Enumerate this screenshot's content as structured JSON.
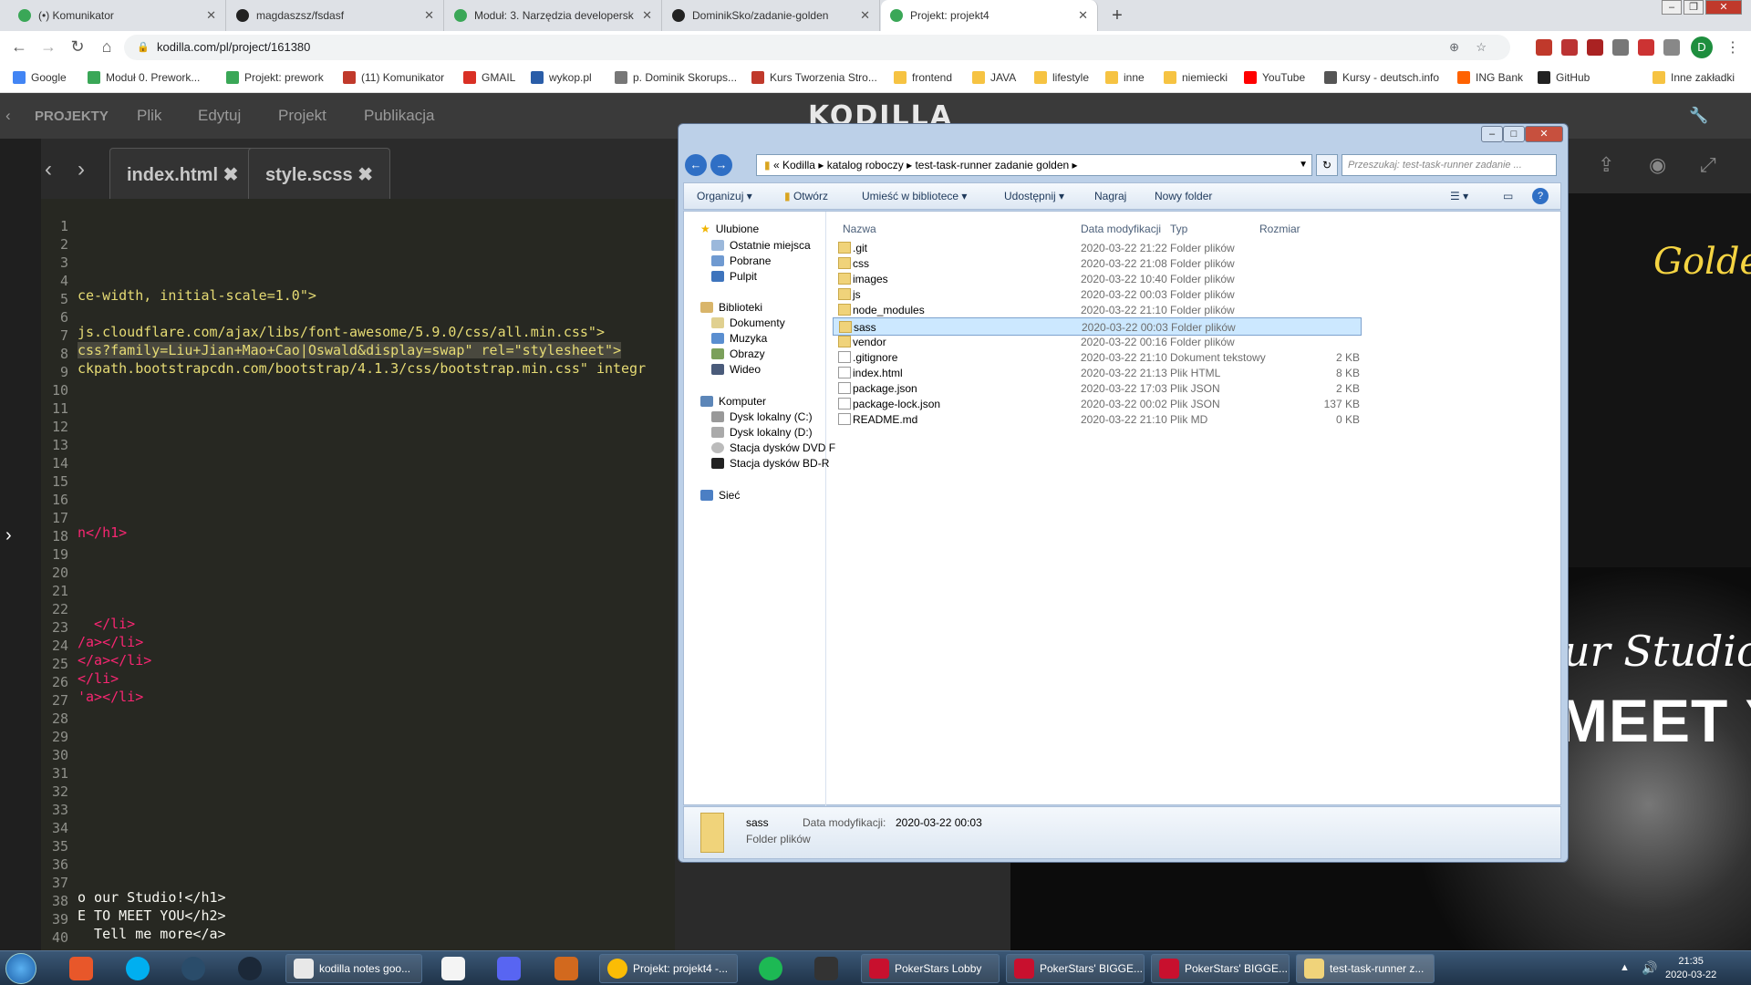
{
  "browser": {
    "tabs": [
      {
        "label": "(•) Komunikator",
        "color": "#3aa757"
      },
      {
        "label": "magdaszsz/fsdasf",
        "color": "#222222"
      },
      {
        "label": "Moduł: 3. Narzędzia developersk",
        "color": "#3aa757"
      },
      {
        "label": "DominikSko/zadanie-golden",
        "color": "#222222"
      },
      {
        "label": "Projekt: projekt4",
        "color": "#3aa757"
      }
    ],
    "url": "kodilla.com/pl/project/161380",
    "profile_initial": "D",
    "bookmarks": [
      "Google",
      "Moduł 0. Prework...",
      "Projekt: prework",
      "(11) Komunikator",
      "GMAIL",
      "wykop.pl",
      "p. Dominik Skorups...",
      "Kurs Tworzenia Stro...",
      "frontend",
      "JAVA",
      "lifestyle",
      "inne",
      "niemiecki",
      "YouTube",
      "Kursy - deutsch.info",
      "ING Bank",
      "GitHub",
      "Inne zakładki"
    ]
  },
  "app": {
    "nav": {
      "projects": "PROJEKTY",
      "file": "Plik",
      "edit": "Edytuj",
      "project": "Projekt",
      "publish": "Publikacja"
    },
    "logo": "KODILLA",
    "editor_tabs": [
      "index.html",
      "style.scss"
    ],
    "line_numbers": [
      "1",
      "2",
      "3",
      "4",
      "5",
      "6",
      "7",
      "8",
      "9",
      "10",
      "11",
      "12",
      "13",
      "14",
      "15",
      "16",
      "17",
      "18",
      "19",
      "20",
      "21",
      "22",
      "23",
      "24",
      "25",
      "26",
      "27",
      "28",
      "29",
      "30",
      "31",
      "32",
      "33",
      "34",
      "35",
      "36",
      "37",
      "38",
      "39",
      "40"
    ],
    "code": {
      "l5": "ce-width, initial-scale=1.0\">",
      "l7": "js.cloudflare.com/ajax/libs/font-awesome/5.9.0/css/all.min.css\">",
      "l8": "css?family=Liu+Jian+Mao+Cao|Oswald&display=swap\" rel=\"stylesheet\">",
      "l9": "ckpath.bootstrapcdn.com/bootstrap/4.1.3/css/bootstrap.min.css\" integr",
      "l18": "n</h1>",
      "l23": "  </li>",
      "l24": "/a></li>",
      "l25": "</a></li>",
      "l26": "</li>",
      "l27": "'a></li>",
      "l38": "o our Studio!</h1>",
      "l39": "E TO MEET YOU</h2>",
      "l40": "  Tell me more</a>"
    },
    "preview": {
      "golden": "Golde",
      "studio": "ur Studio!",
      "meet": "MEET YO"
    }
  },
  "explorer": {
    "breadcrumb": [
      "Kodilla",
      "katalog roboczy",
      "test-task-runner zadanie golden"
    ],
    "search_placeholder": "Przeszukaj: test-task-runner zadanie ...",
    "commands": [
      "Organizuj",
      "Otwórz",
      "Umieść w bibliotece",
      "Udostępnij",
      "Nagraj",
      "Nowy folder"
    ],
    "nav": {
      "favorites": "Ulubione",
      "recent": "Ostatnie miejsca",
      "downloads": "Pobrane",
      "desktop": "Pulpit",
      "libraries": "Biblioteki",
      "documents": "Dokumenty",
      "music": "Muzyka",
      "pictures": "Obrazy",
      "video": "Wideo",
      "computer": "Komputer",
      "disk_c": "Dysk lokalny (C:)",
      "disk_d": "Dysk lokalny (D:)",
      "dvd": "Stacja dysków DVD F",
      "bd": "Stacja dysków BD-R",
      "network": "Sieć"
    },
    "columns": {
      "name": "Nazwa",
      "modified": "Data modyfikacji",
      "type": "Typ",
      "size": "Rozmiar"
    },
    "files": [
      {
        "name": ".git",
        "modified": "2020-03-22 21:22",
        "type": "Folder plików",
        "size": "",
        "folder": true
      },
      {
        "name": "css",
        "modified": "2020-03-22 21:08",
        "type": "Folder plików",
        "size": "",
        "folder": true
      },
      {
        "name": "images",
        "modified": "2020-03-22 10:40",
        "type": "Folder plików",
        "size": "",
        "folder": true
      },
      {
        "name": "js",
        "modified": "2020-03-22 00:03",
        "type": "Folder plików",
        "size": "",
        "folder": true
      },
      {
        "name": "node_modules",
        "modified": "2020-03-22 21:10",
        "type": "Folder plików",
        "size": "",
        "folder": true
      },
      {
        "name": "sass",
        "modified": "2020-03-22 00:03",
        "type": "Folder plików",
        "size": "",
        "folder": true
      },
      {
        "name": "vendor",
        "modified": "2020-03-22 00:16",
        "type": "Folder plików",
        "size": "",
        "folder": true
      },
      {
        "name": ".gitignore",
        "modified": "2020-03-22 21:10",
        "type": "Dokument tekstowy",
        "size": "2 KB",
        "folder": false
      },
      {
        "name": "index.html",
        "modified": "2020-03-22 21:13",
        "type": "Plik HTML",
        "size": "8 KB",
        "folder": false
      },
      {
        "name": "package.json",
        "modified": "2020-03-22 17:03",
        "type": "Plik JSON",
        "size": "2 KB",
        "folder": false
      },
      {
        "name": "package-lock.json",
        "modified": "2020-03-22 00:02",
        "type": "Plik JSON",
        "size": "137 KB",
        "folder": false
      },
      {
        "name": "README.md",
        "modified": "2020-03-22 21:10",
        "type": "Plik MD",
        "size": "0 KB",
        "folder": false
      }
    ],
    "details": {
      "name": "sass",
      "modified_label": "Data modyfikacji:",
      "modified": "2020-03-22 00:03",
      "type": "Folder plików"
    }
  },
  "taskbar": {
    "items": [
      "kodilla notes goo...",
      "Projekt: projekt4 -...",
      "PokerStars Lobby",
      "PokerStars' BIGGE...",
      "PokerStars' BIGGE...",
      "test-task-runner z..."
    ],
    "time": "21:35",
    "date": "2020-03-22"
  }
}
